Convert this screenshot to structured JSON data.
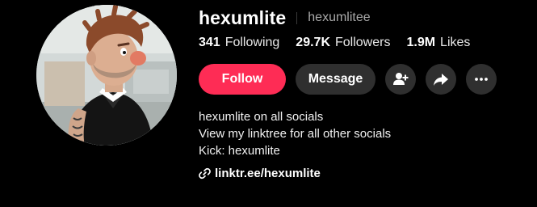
{
  "profile": {
    "display_name": "hexumlite",
    "username": "hexumlitee",
    "avatar_icon": "cartoon-avatar-icon"
  },
  "stats": {
    "following_count": "341",
    "following_label": "Following",
    "followers_count": "29.7K",
    "followers_label": "Followers",
    "likes_count": "1.9M",
    "likes_label": "Likes"
  },
  "actions": {
    "follow_label": "Follow",
    "message_label": "Message",
    "icons": [
      "add-friend-icon",
      "share-icon",
      "more-icon"
    ]
  },
  "bio": {
    "lines": [
      "hexumlite on all socials",
      "View my linktree for all other socials",
      "Kick: hexumlite"
    ]
  },
  "link": {
    "text": "linktr.ee/hexumlite",
    "icon": "link-icon"
  },
  "colors": {
    "background": "#000000",
    "follow_button": "#fe2c55",
    "secondary_button": "#2f2f2f",
    "muted_text": "#a9a9a9"
  }
}
